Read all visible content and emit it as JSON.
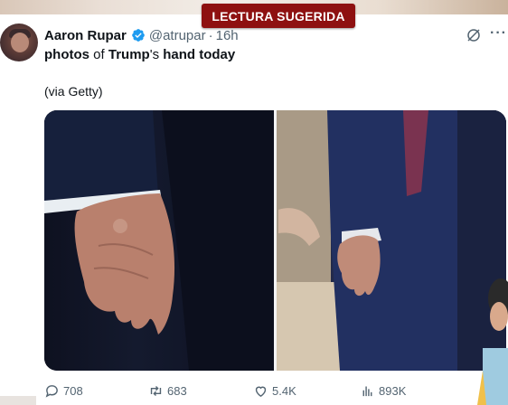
{
  "banner": {
    "text": "LECTURA SUGERIDA",
    "color": "#8e1111"
  },
  "tweet": {
    "author_name": "Aaron Rupar",
    "verified_icon": "verified-badge-icon",
    "handle": "@atrupar",
    "separator": "·",
    "time": "16h",
    "text_parts": [
      "photos",
      " of ",
      "Trump",
      "'s ",
      "hand today"
    ],
    "via": "(via Getty)",
    "media": {
      "count": 2,
      "description_icons": [
        "photo-left",
        "photo-right"
      ]
    }
  },
  "actions": {
    "replies": "708",
    "reposts": "683",
    "likes": "5.4K",
    "views": "893K"
  },
  "colors": {
    "text": "#0f1419",
    "muted": "#536471",
    "verified": "#1d9bf0"
  }
}
